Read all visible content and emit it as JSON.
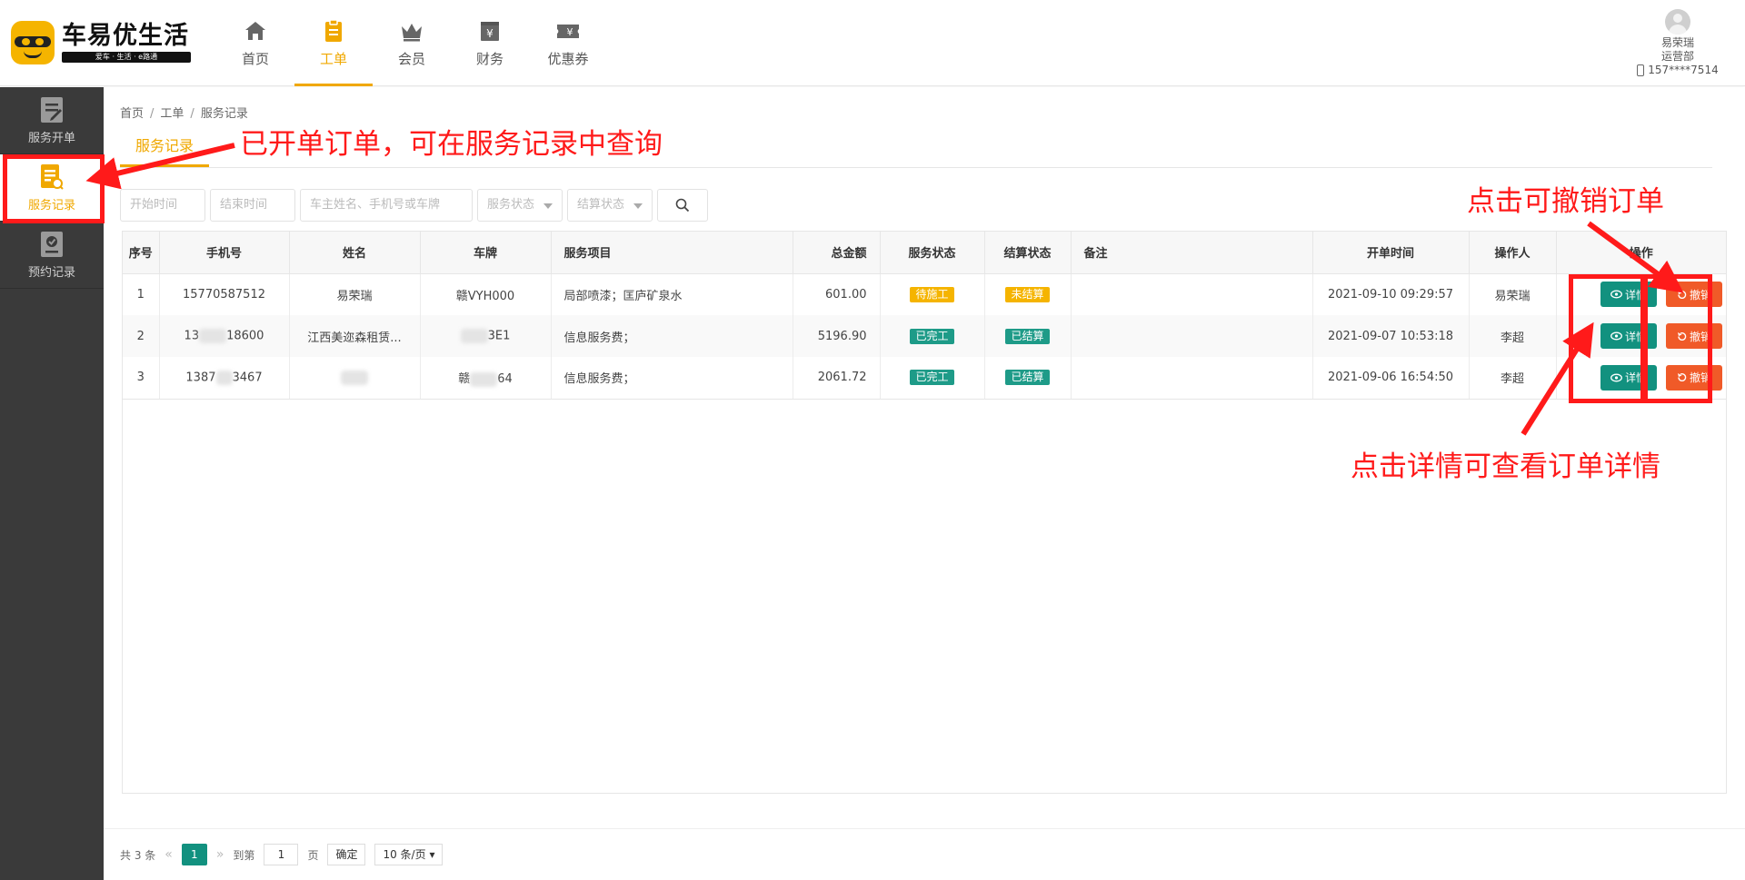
{
  "brand": {
    "name": "车易优生活",
    "slogan": "爱车 · 生活 · e路通"
  },
  "nav": [
    {
      "label": "首页",
      "icon": "home-icon"
    },
    {
      "label": "工单",
      "icon": "clipboard-icon",
      "active": true
    },
    {
      "label": "会员",
      "icon": "crown-icon"
    },
    {
      "label": "财务",
      "icon": "finance-icon"
    },
    {
      "label": "优惠券",
      "icon": "coupon-icon"
    }
  ],
  "user": {
    "name": "易荣瑞",
    "dept": "运营部",
    "phone": "157****7514"
  },
  "sidebar": [
    {
      "label": "服务开单",
      "icon": "edit-doc-icon"
    },
    {
      "label": "服务记录",
      "icon": "record-search-icon",
      "active": true
    },
    {
      "label": "预约记录",
      "icon": "appointment-icon"
    }
  ],
  "breadcrumb": [
    "首页",
    "工单",
    "服务记录"
  ],
  "page_title": "服务记录",
  "filters": {
    "start_placeholder": "开始时间",
    "end_placeholder": "结束时间",
    "keyword_placeholder": "车主姓名、手机号或车牌",
    "service_status": "服务状态",
    "settle_status": "结算状态"
  },
  "table": {
    "headers": [
      "序号",
      "手机号",
      "姓名",
      "车牌",
      "服务项目",
      "总金额",
      "服务状态",
      "结算状态",
      "备注",
      "开单时间",
      "操作人",
      "操作"
    ],
    "rows": [
      {
        "no": "1",
        "phone_a": "15770587512",
        "phone_b": "",
        "name": "易荣瑞",
        "plate_a": "赣VYH000",
        "plate_b": "",
        "item": "局部喷漆；匡庐矿泉水",
        "amount": "601.00",
        "service": "待施工",
        "service_color": "yellow",
        "settle": "未结算",
        "settle_color": "yellow",
        "remark": "",
        "time": "2021-09-10 09:29:57",
        "operator": "易荣瑞"
      },
      {
        "no": "2",
        "phone_a": "13",
        "phone_b": "18600",
        "name": "江西美迩森租赁...",
        "plate_a": "",
        "plate_b": "3E1",
        "item": "信息服务费；",
        "amount": "5196.90",
        "service": "已完工",
        "service_color": "green",
        "settle": "已结算",
        "settle_color": "green",
        "remark": "",
        "time": "2021-09-07 10:53:18",
        "operator": "李超"
      },
      {
        "no": "3",
        "phone_a": "1387",
        "phone_b": "3467",
        "name": "",
        "plate_a": "赣",
        "plate_b": "64",
        "item": "信息服务费；",
        "amount": "2061.72",
        "service": "已完工",
        "service_color": "green",
        "settle": "已结算",
        "settle_color": "green",
        "remark": "",
        "time": "2021-09-06 16:54:50",
        "operator": "李超"
      }
    ],
    "detail_label": "详情",
    "cancel_label": "撤销"
  },
  "pagination": {
    "total": "共 3 条",
    "current": "1",
    "goto_label": "到第",
    "goto_value": "1",
    "page_unit": "页",
    "confirm": "确定",
    "page_size": "10 条/页"
  },
  "annotations": {
    "sidebar_note": "已开单订单，可在服务记录中查询",
    "cancel_note": "点击可撤销订单",
    "detail_note": "点击详情可查看订单详情"
  },
  "colors": {
    "accent": "#f0a800",
    "green": "#12917f",
    "orange": "#f05a28",
    "annotation": "#ff1a1a",
    "sidebar": "#3a3a3a"
  }
}
